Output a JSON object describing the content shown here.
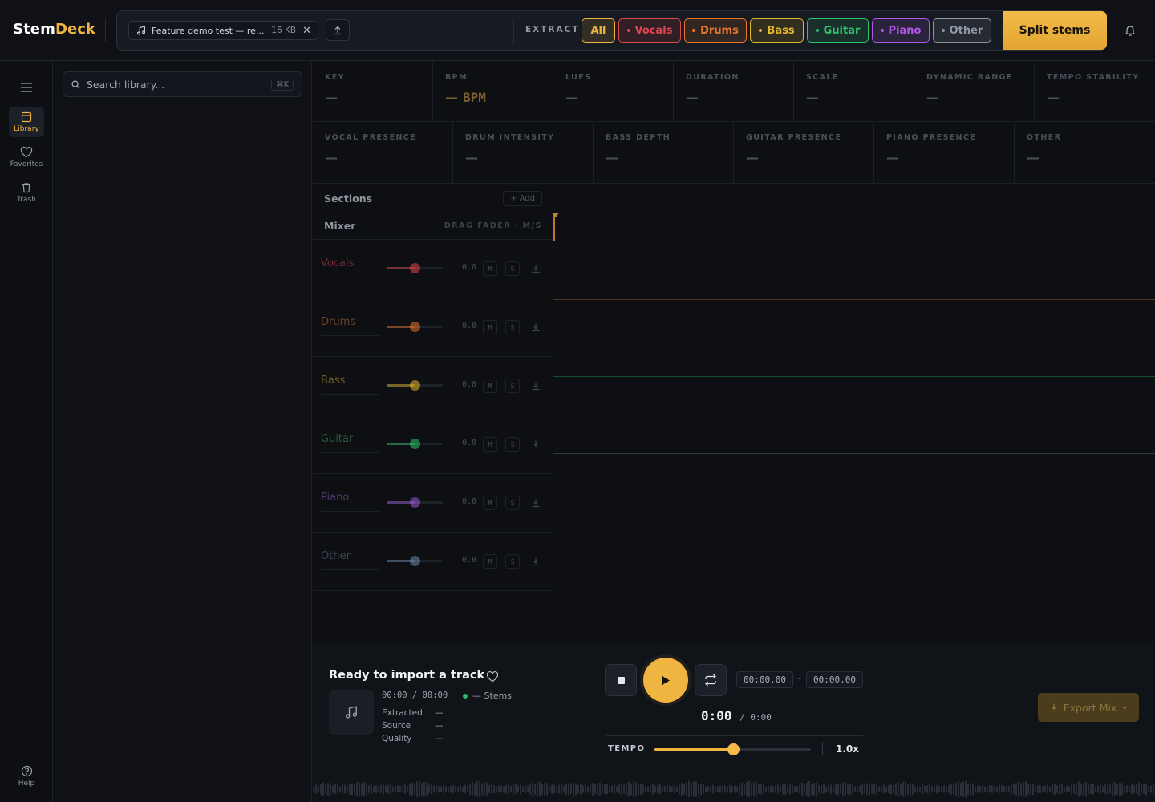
{
  "app": {
    "name_primary": "Stem",
    "name_accent": "Deck"
  },
  "toolbar": {
    "file_name": "Feature demo test — re...",
    "file_size": "16 KB",
    "extract_label": "EXTRACT",
    "stems": [
      {
        "label": "All",
        "color": "#f0b440",
        "active": true
      },
      {
        "label": "Vocals",
        "color": "#e0454e"
      },
      {
        "label": "Drums",
        "color": "#e7752c"
      },
      {
        "label": "Bass",
        "color": "#e5b82c"
      },
      {
        "label": "Guitar",
        "color": "#2fc46b"
      },
      {
        "label": "Piano",
        "color": "#b157e8"
      },
      {
        "label": "Other",
        "color": "#8e96a3"
      }
    ],
    "split_label": "Split stems"
  },
  "rail": {
    "items": [
      {
        "label": "Library",
        "icon": "library-icon",
        "active": true
      },
      {
        "label": "Favorites",
        "icon": "heart-icon"
      },
      {
        "label": "Trash",
        "icon": "trash-icon"
      }
    ],
    "help_label": "Help"
  },
  "library": {
    "search_placeholder": "Search library...",
    "shortcut": "⌘K"
  },
  "metrics_row1": [
    {
      "label": "KEY",
      "value": "—"
    },
    {
      "label": "BPM",
      "value": "—",
      "unit": "BPM"
    },
    {
      "label": "LUFS",
      "value": "—"
    },
    {
      "label": "DURATION",
      "value": "—"
    },
    {
      "label": "SCALE",
      "value": "—"
    },
    {
      "label": "DYNAMIC RANGE",
      "value": "—"
    },
    {
      "label": "TEMPO STABILITY",
      "value": "—"
    }
  ],
  "metrics_row2": [
    {
      "label": "VOCAL PRESENCE",
      "value": "—"
    },
    {
      "label": "DRUM INTENSITY",
      "value": "—"
    },
    {
      "label": "BASS DEPTH",
      "value": "—"
    },
    {
      "label": "GUITAR PRESENCE",
      "value": "—"
    },
    {
      "label": "PIANO PRESENCE",
      "value": "—"
    },
    {
      "label": "OTHER",
      "value": "—"
    }
  ],
  "sections": {
    "title": "Sections",
    "add_label": "+ Add"
  },
  "mixer": {
    "title": "Mixer",
    "hint": "DRAG FADER · M/S",
    "mute_label": "M",
    "solo_label": "S",
    "tracks": [
      {
        "name": "Vocals",
        "gain": "0.0",
        "level": 0.5,
        "color": "#e0454e",
        "name_color": "#6e2d33"
      },
      {
        "name": "Drums",
        "gain": "0.0",
        "level": 0.5,
        "color": "#e7752c",
        "name_color": "#6e4526"
      },
      {
        "name": "Bass",
        "gain": "0.0",
        "level": 0.5,
        "color": "#e5b82c",
        "name_color": "#6c5a26"
      },
      {
        "name": "Guitar",
        "gain": "0.0",
        "level": 0.5,
        "color": "#2fc46b",
        "name_color": "#2c5a3b"
      },
      {
        "name": "Piano",
        "gain": "0.0",
        "level": 0.5,
        "color": "#9a5ad4",
        "name_color": "#4f3a68"
      },
      {
        "name": "Other",
        "gain": "0.0",
        "level": 0.5,
        "color": "#6b8aa8",
        "name_color": "#3c4552"
      }
    ]
  },
  "player": {
    "title": "Ready to import a track",
    "time": "00:00 / 00:00",
    "stems_label": "— Stems",
    "meta": [
      {
        "label": "Extracted",
        "value": "—"
      },
      {
        "label": "Source",
        "value": "—"
      },
      {
        "label": "Quality",
        "value": "—"
      }
    ],
    "loop_start": "00:00.00",
    "loop_end": "00:00.00",
    "loop_dash": "-",
    "current": "0:00",
    "total": "/ 0:00",
    "tempo_label": "TEMPO",
    "tempo_value": "1.0x",
    "tempo_level": 0.5,
    "export_label": "Export Mix"
  }
}
